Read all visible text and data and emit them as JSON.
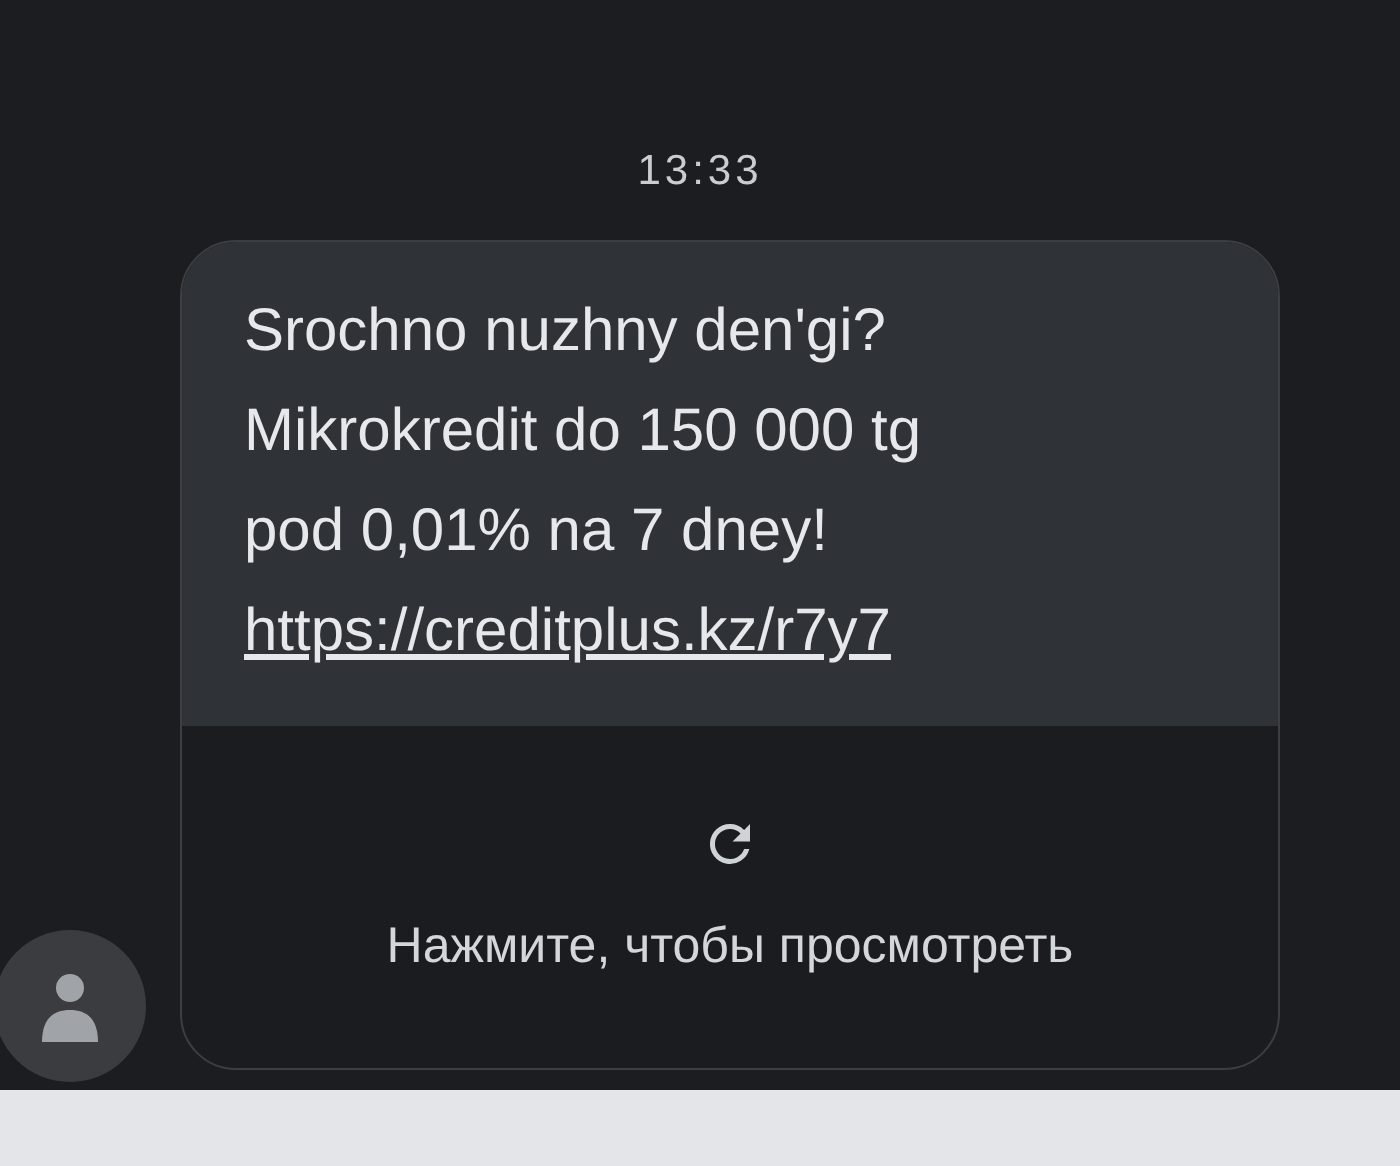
{
  "timestamp": "13:33",
  "message": {
    "text": "Srochno nuzhny den'gi?\nMikrokredit do 150 000 tg\npod 0,01% na 7 dney!",
    "link": "https://creditplus.kz/r7y7",
    "preview_action": "Нажмите, чтобы просмотреть"
  }
}
